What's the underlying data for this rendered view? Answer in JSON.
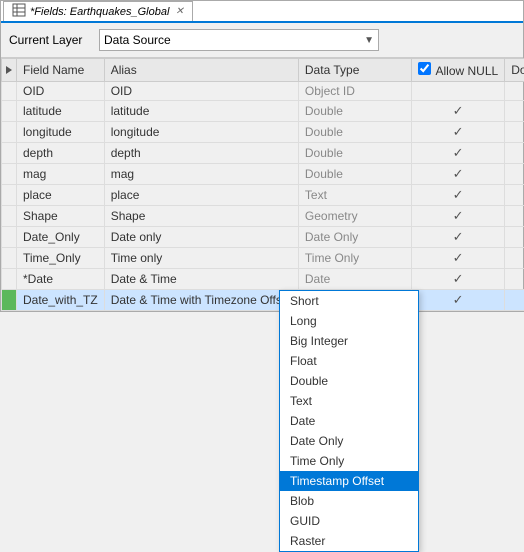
{
  "window": {
    "title": "*Fields: Earthquakes_Global",
    "icon": "table-icon"
  },
  "current_layer": {
    "label": "Current Layer",
    "value": "Data Source",
    "placeholder": "Data Source"
  },
  "table": {
    "columns": [
      {
        "id": "indicator",
        "label": ""
      },
      {
        "id": "field_name",
        "label": "Field Name",
        "sortable": true
      },
      {
        "id": "alias",
        "label": "Alias"
      },
      {
        "id": "data_type",
        "label": "Data Type"
      },
      {
        "id": "allow_null",
        "label": "Allow NULL",
        "has_checkbox": true
      },
      {
        "id": "domain",
        "label": "Domain"
      }
    ],
    "rows": [
      {
        "indicator": "",
        "field_name": "OID",
        "alias": "OID",
        "data_type": "Object ID",
        "allow_null": false,
        "domain": "",
        "highlighted": false
      },
      {
        "indicator": "",
        "field_name": "latitude",
        "alias": "latitude",
        "data_type": "Double",
        "allow_null": true,
        "domain": "",
        "highlighted": false
      },
      {
        "indicator": "",
        "field_name": "longitude",
        "alias": "longitude",
        "data_type": "Double",
        "allow_null": true,
        "domain": "",
        "highlighted": false
      },
      {
        "indicator": "",
        "field_name": "depth",
        "alias": "depth",
        "data_type": "Double",
        "allow_null": true,
        "domain": "",
        "highlighted": false
      },
      {
        "indicator": "",
        "field_name": "mag",
        "alias": "mag",
        "data_type": "Double",
        "allow_null": true,
        "domain": "",
        "highlighted": false
      },
      {
        "indicator": "",
        "field_name": "place",
        "alias": "place",
        "data_type": "Text",
        "allow_null": true,
        "domain": "",
        "highlighted": false
      },
      {
        "indicator": "",
        "field_name": "Shape",
        "alias": "Shape",
        "data_type": "Geometry",
        "allow_null": true,
        "domain": "",
        "highlighted": false
      },
      {
        "indicator": "",
        "field_name": "Date_Only",
        "alias": "Date only",
        "data_type": "Date Only",
        "allow_null": true,
        "domain": "",
        "highlighted": false
      },
      {
        "indicator": "",
        "field_name": "Time_Only",
        "alias": "Time only",
        "data_type": "Time Only",
        "allow_null": true,
        "domain": "",
        "highlighted": false
      },
      {
        "indicator": "",
        "field_name": "*Date",
        "alias": "Date & Time",
        "data_type": "Date",
        "allow_null": true,
        "domain": "",
        "highlighted": false
      },
      {
        "indicator": "green",
        "field_name": "Date_with_TZ",
        "alias": "Date & Time with Timezone Offset",
        "data_type": "Timestamp Offset",
        "allow_null": true,
        "domain": "",
        "highlighted": true,
        "has_dropdown": true
      }
    ]
  },
  "dropdown_popup": {
    "items": [
      {
        "label": "Short",
        "selected": false
      },
      {
        "label": "Long",
        "selected": false
      },
      {
        "label": "Big Integer",
        "selected": false
      },
      {
        "label": "Float",
        "selected": false
      },
      {
        "label": "Double",
        "selected": false
      },
      {
        "label": "Text",
        "selected": false
      },
      {
        "label": "Date",
        "selected": false
      },
      {
        "label": "Date Only",
        "selected": false
      },
      {
        "label": "Time Only",
        "selected": false
      },
      {
        "label": "Timestamp Offset",
        "selected": true
      },
      {
        "label": "Blob",
        "selected": false
      },
      {
        "label": "GUID",
        "selected": false
      },
      {
        "label": "Raster",
        "selected": false
      }
    ]
  }
}
